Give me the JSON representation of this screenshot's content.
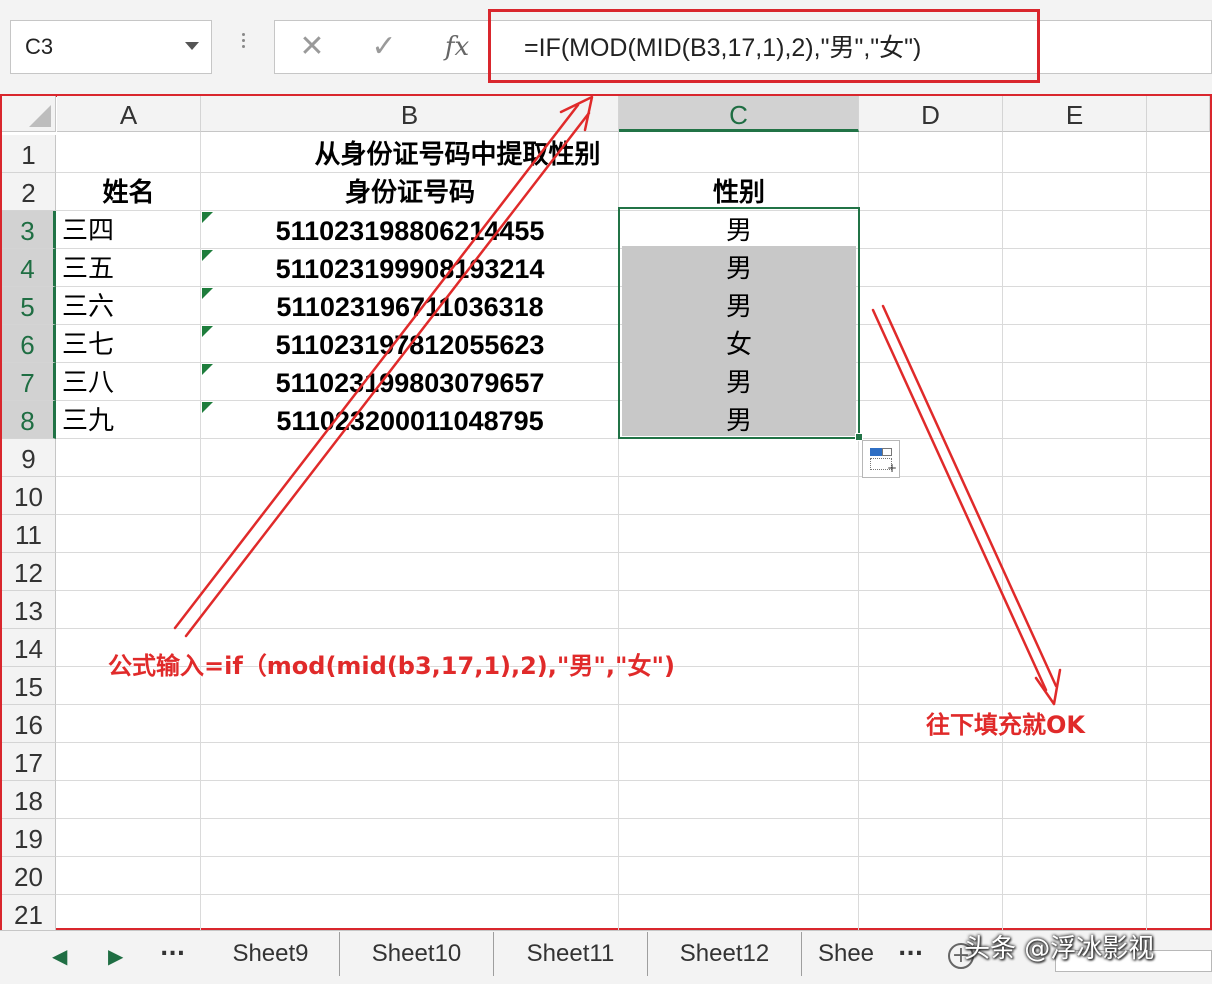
{
  "formula_bar": {
    "name_box": "C3",
    "cancel_glyph": "✕",
    "enter_glyph": "✓",
    "fx_label": "fx",
    "formula": "=IF(MOD(MID(B3,17,1),2),\"男\",\"女\")"
  },
  "columns": [
    "A",
    "B",
    "C",
    "D",
    "E"
  ],
  "rows": [
    "1",
    "2",
    "3",
    "4",
    "5",
    "6",
    "7",
    "8",
    "9",
    "10",
    "11",
    "12",
    "13",
    "14",
    "15",
    "16",
    "17",
    "18",
    "19",
    "20",
    "21"
  ],
  "sheet": {
    "title": "从身份证号码中提取性别",
    "headers": {
      "name": "姓名",
      "id": "身份证号码",
      "gender": "性别"
    },
    "records": [
      {
        "name": "三四",
        "id": "511023198806214455",
        "gender": "男"
      },
      {
        "name": "三五",
        "id": "511023199908193214",
        "gender": "男"
      },
      {
        "name": "三六",
        "id": "511023196711036318",
        "gender": "男"
      },
      {
        "name": "三七",
        "id": "511023197812055623",
        "gender": "女"
      },
      {
        "name": "三八",
        "id": "511023199803079657",
        "gender": "男"
      },
      {
        "name": "三九",
        "id": "511023200011048795",
        "gender": "男"
      }
    ]
  },
  "annotations": {
    "formula_note": "公式输入=if（mod(mid(b3,17,1),2),\"男\",\"女\")",
    "fill_note": "往下填充就OK",
    "color": "#e02a2a"
  },
  "tabs": {
    "prev": "◀",
    "next": "▶",
    "more": "...",
    "items": [
      "Sheet9",
      "Sheet10",
      "Sheet11",
      "Sheet12",
      "Shee"
    ],
    "more_right": "...",
    "add": "+"
  },
  "watermark": "头条 @浮冰影视",
  "colors": {
    "accent": "#217346",
    "highlight": "#d9262d"
  }
}
